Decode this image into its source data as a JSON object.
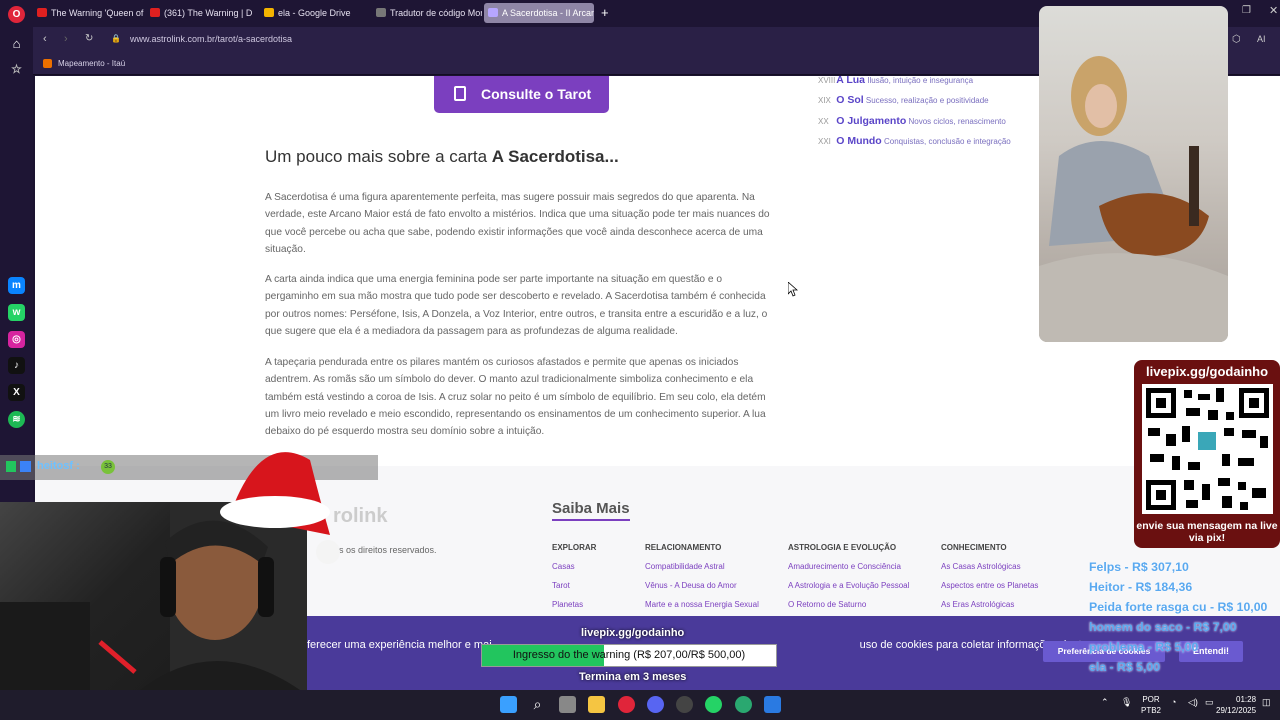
{
  "browser": {
    "tabs": [
      {
        "label": "The Warning 'Queen of th"
      },
      {
        "label": "(361) The Warning | D"
      },
      {
        "label": "ela - Google Drive"
      },
      {
        "label": "Tradutor de código Morse"
      },
      {
        "label": "A Sacerdotisa - II Arcano I"
      }
    ],
    "url": "www.astrolink.com.br/tarot/a-sacerdotisa",
    "bookmark": "Mapeamento - Itaú",
    "ai_label": "AI"
  },
  "page": {
    "tarot_button": "Consulte o Tarot",
    "about_prefix": "Um pouco mais sobre a carta ",
    "about_card": "A Sacerdotisa...",
    "paragraphs": [
      "A Sacerdotisa é uma figura aparentemente perfeita, mas sugere possuir mais segredos do que aparenta. Na verdade, este Arcano Maior está de fato envolto a mistérios. Indica que uma situação pode ter mais nuances do que você percebe ou acha que sabe, podendo existir informações que você ainda desconhece acerca de uma situação.",
      "A carta ainda indica que uma energia feminina pode ser parte importante na situação em questão e o pergaminho em sua mão mostra que tudo pode ser descoberto e revelado. A Sacerdotisa também é conhecida por outros nomes: Perséfone, Isis, A Donzela, a Voz Interior, entre outros, e transita entre a escuridão e a luz, o que sugere que ela é a mediadora da passagem para as profundezas de alguma realidade.",
      "A tapeçaria pendurada entre os pilares mantém os curiosos afastados e permite que apenas os iniciados adentrem. As romãs são um símbolo do dever. O manto azul tradicionalmente simboliza conhecimento e ela também está vestindo a coroa de Isis. A cruz solar no peito é um símbolo de equilíbrio. Em seu colo, ela detém um livro meio revelado e meio escondido, representando os ensinamentos de um conhecimento superior. A lua debaixo do pé esquerdo mostra seu domínio sobre a intuição."
    ],
    "cards": [
      {
        "num": "XVIII",
        "name": "A Lua",
        "desc": "Ilusão, intuição e insegurança"
      },
      {
        "num": "XIX",
        "name": "O Sol",
        "desc": "Sucesso, realização e positividade"
      },
      {
        "num": "XX",
        "name": "O Julgamento",
        "desc": "Novos ciclos, renascimento"
      },
      {
        "num": "XXI",
        "name": "O Mundo",
        "desc": "Conquistas, conclusão e integração"
      }
    ],
    "footer": {
      "logo": "rolink",
      "rights": "s os direitos reservados.",
      "saiba": "Saiba Mais",
      "columns": [
        {
          "head": "EXPLORAR",
          "links": [
            "Casas",
            "Tarot",
            "Planetas"
          ]
        },
        {
          "head": "RELACIONAMENTO",
          "links": [
            "Compatibilidade Astral",
            "Vênus - A Deusa do Amor",
            "Marte e a nossa Energia Sexual"
          ]
        },
        {
          "head": "ASTROLOGIA E EVOLUÇÃO",
          "links": [
            "Amadurecimento e Consciência",
            "A Astrologia e a Evolução Pessoal",
            "O Retorno de Saturno"
          ]
        },
        {
          "head": "CONHECIMENTO",
          "links": [
            "As Casas Astrológicas",
            "Aspectos entre os Planetas",
            "As Eras Astrológicas"
          ]
        }
      ]
    },
    "cookie": {
      "text_left": "ferecer uma experiência melhor e mai",
      "text_right": "uso de cookies para coletar informações dentro e",
      "pref_button": "Preferência de cookies",
      "ok_button": "Entendi!"
    }
  },
  "overlay": {
    "goal_url": "livepix.gg/godainho",
    "goal_text": "Ingresso do the warning (R$ 207,00/R$ 500,00)",
    "goal_progress": 0.414,
    "goal_end": "Termina em 3 meses",
    "qr_top": "livepix.gg/godainho",
    "qr_bottom": "envie sua mensagem na live via pix!",
    "donors": [
      "Felps - R$ 307,10",
      "Heitor - R$ 184,36",
      "Peida forte rasga cu - R$ 10,00",
      "homem do saco - R$ 7,00",
      "problema - R$ 5,00",
      "ela - R$ 5,00"
    ],
    "chat_user": "heitosf :",
    "chat_emote": "33"
  },
  "taskbar": {
    "lang": "POR",
    "lang2": "PTB2",
    "time": "01:28",
    "date": "29/12/2025"
  },
  "colors": {
    "accent": "#7b3fbf",
    "cookie_bg": "#4a3a9a",
    "progress": "#22c55e",
    "donor": "#5aa9f0"
  }
}
